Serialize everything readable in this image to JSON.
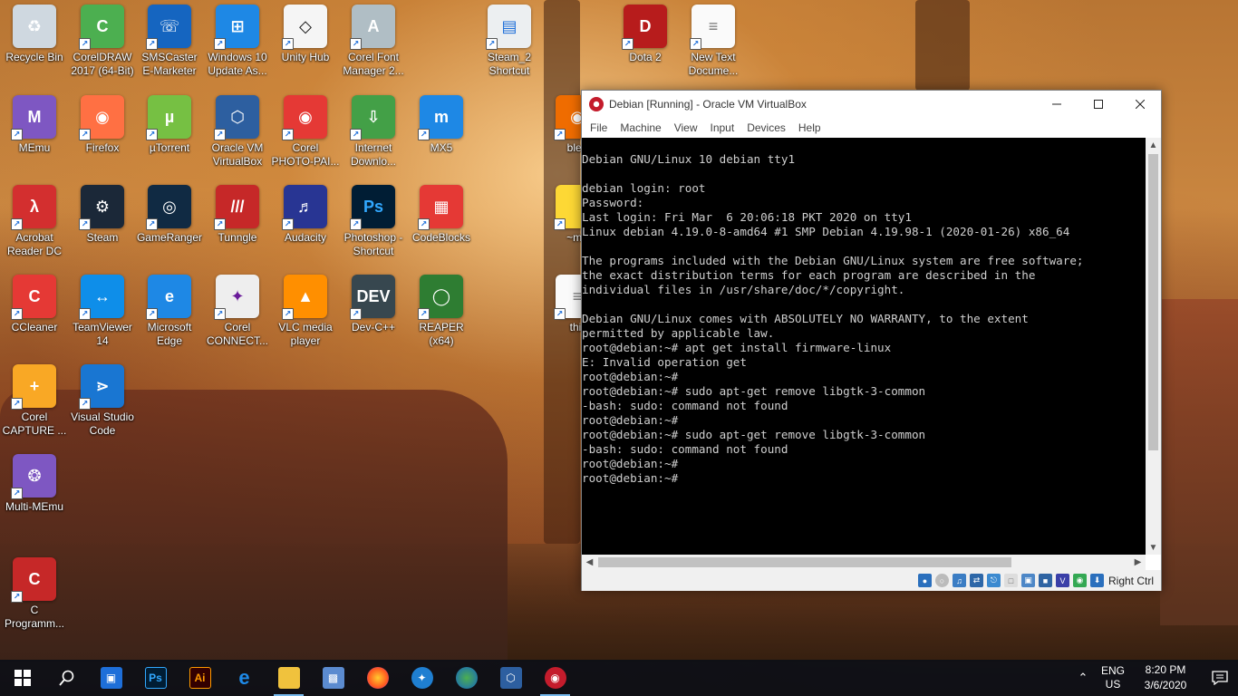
{
  "colors": {
    "accent": "#76b9ed",
    "taskbar_bg": "#0e1016",
    "terminal_bg": "#000000",
    "terminal_fg": "#cfcfcf",
    "virtualbox_brand": "#c41c2c"
  },
  "desktop": {
    "icons": [
      {
        "label": "Recycle Bin",
        "icon": "recycle-bin-icon"
      },
      {
        "label": "CorelDRAW\n2017 (64-Bit)",
        "icon": "coreldraw-icon"
      },
      {
        "label": "SMSCaster\nE-Marketer",
        "icon": "smscaster-icon"
      },
      {
        "label": "Windows 10\nUpdate As...",
        "icon": "windows-update-icon"
      },
      {
        "label": "Unity Hub",
        "icon": "unity-icon"
      },
      {
        "label": "Corel Font\nManager 2...",
        "icon": "corel-font-icon"
      },
      {
        "label": "Steam_2\nShortcut",
        "icon": "document-icon"
      },
      {
        "label": "Dota 2",
        "icon": "dota-icon"
      },
      {
        "label": "New Text\nDocume...",
        "icon": "text-document-icon"
      },
      {
        "label": "MEmu",
        "icon": "memu-icon"
      },
      {
        "label": "Firefox",
        "icon": "firefox-icon"
      },
      {
        "label": "µTorrent",
        "icon": "utorrent-icon"
      },
      {
        "label": "Oracle VM\nVirtualBox",
        "icon": "virtualbox-icon"
      },
      {
        "label": "Corel\nPHOTO-PAI...",
        "icon": "corel-photopaint-icon"
      },
      {
        "label": "Internet\nDownlo...",
        "icon": "idm-icon"
      },
      {
        "label": "MX5",
        "icon": "maxthon-icon"
      },
      {
        "label": "Acrobat\nReader DC",
        "icon": "acrobat-icon"
      },
      {
        "label": "Steam",
        "icon": "steam-icon"
      },
      {
        "label": "GameRanger",
        "icon": "gameranger-icon"
      },
      {
        "label": "Tunngle",
        "icon": "tunngle-icon"
      },
      {
        "label": "Audacity",
        "icon": "audacity-icon"
      },
      {
        "label": "Photoshop -\nShortcut",
        "icon": "photoshop-icon"
      },
      {
        "label": "CodeBlocks",
        "icon": "codeblocks-icon"
      },
      {
        "label": "CCleaner",
        "icon": "ccleaner-icon"
      },
      {
        "label": "TeamViewer\n14",
        "icon": "teamviewer-icon"
      },
      {
        "label": "Microsoft\nEdge",
        "icon": "edge-icon"
      },
      {
        "label": "Corel\nCONNECT...",
        "icon": "corel-connect-icon"
      },
      {
        "label": "VLC media\nplayer",
        "icon": "vlc-icon"
      },
      {
        "label": "Dev-C++",
        "icon": "devcpp-icon"
      },
      {
        "label": "REAPER (x64)",
        "icon": "reaper-icon"
      },
      {
        "label": "Corel\nCAPTURE ...",
        "icon": "corel-capture-icon"
      },
      {
        "label": "Visual Studio\nCode",
        "icon": "vscode-icon"
      },
      {
        "label": "Multi-MEmu",
        "icon": "multi-memu-icon"
      },
      {
        "label": "C\nProgramm...",
        "icon": "c-programming-icon"
      },
      {
        "label": "blen",
        "icon": "blender-icon"
      },
      {
        "label": "~mo",
        "icon": "folder-icon"
      },
      {
        "label": "thir",
        "icon": "text-document-icon"
      }
    ]
  },
  "vbox_window": {
    "title": "Debian [Running] - Oracle VM VirtualBox",
    "menu": [
      "File",
      "Machine",
      "View",
      "Input",
      "Devices",
      "Help"
    ],
    "host_key": "Right Ctrl",
    "terminal_lines": [
      "Debian GNU/Linux 10 debian tty1",
      "",
      "debian login: root",
      "Password:",
      "Last login: Fri Mar  6 20:06:18 PKT 2020 on tty1",
      "Linux debian 4.19.0-8-amd64 #1 SMP Debian 4.19.98-1 (2020-01-26) x86_64",
      "",
      "The programs included with the Debian GNU/Linux system are free software;",
      "the exact distribution terms for each program are described in the",
      "individual files in /usr/share/doc/*/copyright.",
      "",
      "Debian GNU/Linux comes with ABSOLUTELY NO WARRANTY, to the extent",
      "permitted by applicable law.",
      "root@debian:~# apt get install firmware-linux",
      "E: Invalid operation get",
      "root@debian:~#",
      "root@debian:~# sudo apt-get remove libgtk-3-common",
      "-bash: sudo: command not found",
      "root@debian:~#",
      "root@debian:~# sudo apt-get remove libgtk-3-common",
      "-bash: sudo: command not found",
      "root@debian:~#",
      "root@debian:~#"
    ]
  },
  "taskbar": {
    "lang_top": "ENG",
    "lang_bottom": "US",
    "time": "8:20 PM",
    "date": "3/6/2020"
  }
}
